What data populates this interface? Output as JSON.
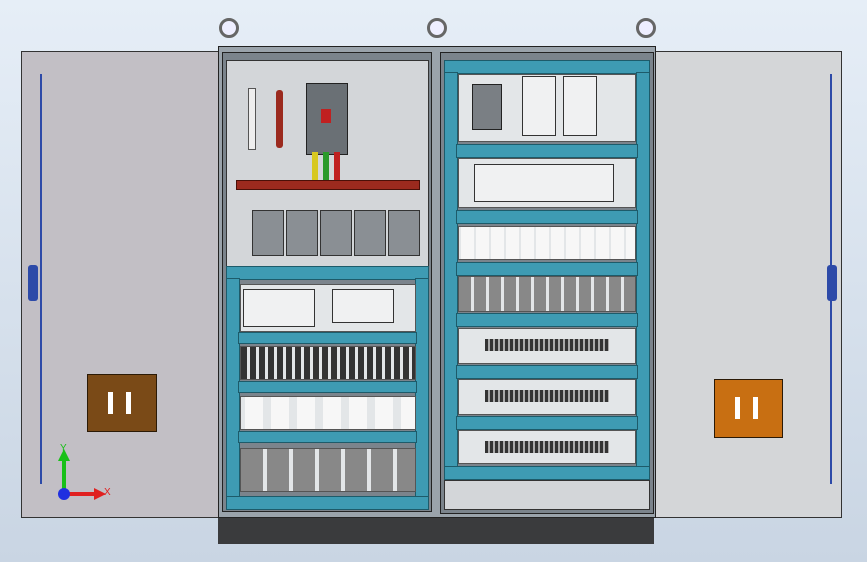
{
  "axes": {
    "x_label": "X",
    "y_label": "Y"
  },
  "colors": {
    "duct": "#3e9bb3",
    "panel": "#d3d6d9",
    "busbar": "#9b2a1e",
    "handle": "#2d4aa8",
    "pocket": "#7a4a17",
    "axis_x": "#e02020",
    "axis_y": "#18c018",
    "axis_z": "#2030e0"
  },
  "components": {
    "left_cabinet": [
      "main-breaker",
      "busbar",
      "branch-breakers",
      "plc-and-power-supply",
      "terminal-block-row",
      "relay-row",
      "contactor-row"
    ],
    "right_cabinet": [
      "motor-breakers-and-power-supplies",
      "plc-modules",
      "relay-row",
      "contactor-row",
      "terminal-strips"
    ]
  }
}
